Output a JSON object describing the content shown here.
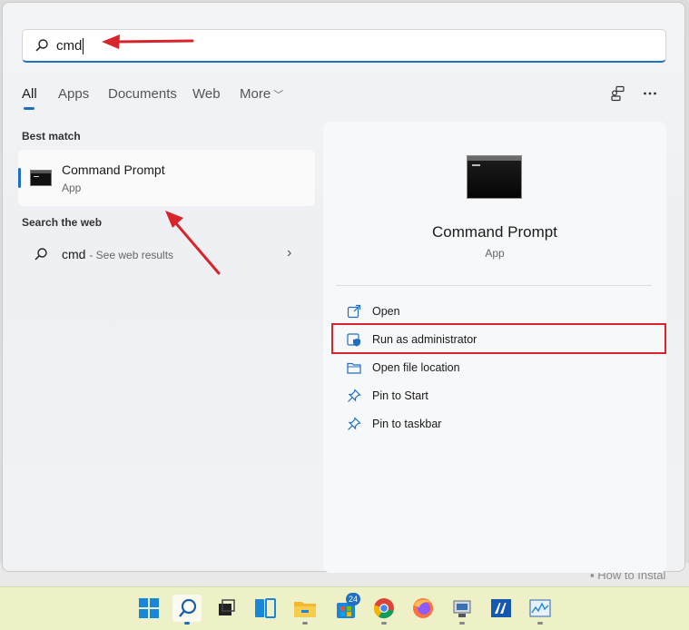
{
  "background_page": {
    "text": "How to Instal"
  },
  "search": {
    "query": "cmd"
  },
  "tabs": {
    "all": "All",
    "apps": "Apps",
    "documents": "Documents",
    "web": "Web",
    "more": "More"
  },
  "icons": {
    "search": "search-icon",
    "more_chevron": "chevron-down-icon",
    "share": "connected-devices-icon",
    "overflow": "ellipsis-icon",
    "open": "open-external-icon",
    "run_admin": "shield-icon",
    "open_location": "folder-icon",
    "pin": "pin-icon"
  },
  "best_match": {
    "header": "Best match",
    "title": "Command Prompt",
    "subtitle": "App"
  },
  "web_search": {
    "header": "Search the web",
    "query": "cmd",
    "suffix": "- See web results"
  },
  "detail": {
    "title": "Command Prompt",
    "subtitle": "App",
    "actions": [
      {
        "label": "Open"
      },
      {
        "label": "Run as administrator"
      },
      {
        "label": "Open file location"
      },
      {
        "label": "Pin to Start"
      },
      {
        "label": "Pin to taskbar"
      }
    ]
  },
  "taskbar": {
    "items": [
      "start",
      "search",
      "task-view",
      "widgets",
      "file-explorer",
      "store",
      "chrome",
      "firefox",
      "app-1",
      "app-2",
      "app-3"
    ],
    "store_badge": "24"
  },
  "colors": {
    "accent": "#1f6fc5",
    "highlight": "#d8242b",
    "taskbar": "#eef0c7"
  }
}
